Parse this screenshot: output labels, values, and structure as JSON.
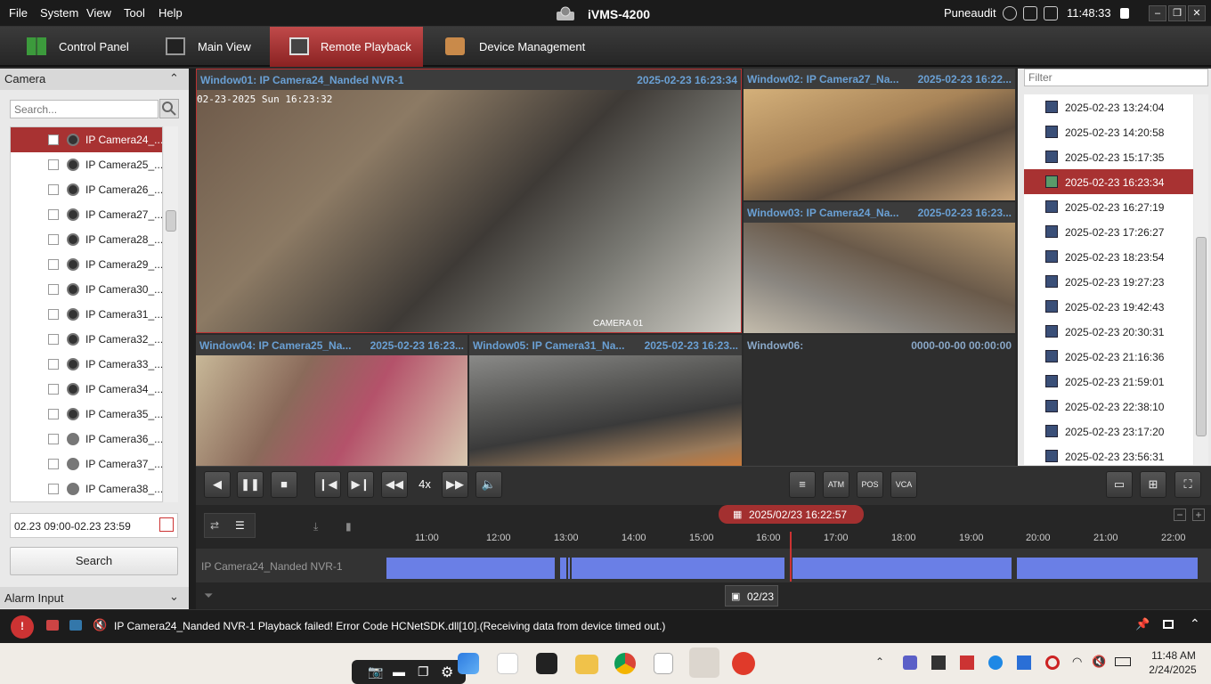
{
  "menubar": {
    "items": [
      "File",
      "System",
      "View",
      "Tool",
      "Help"
    ],
    "title": "iVMS-4200",
    "user": "Puneaudit",
    "clock": "11:48:33"
  },
  "modules": [
    {
      "label": "Control Panel"
    },
    {
      "label": "Main View"
    },
    {
      "label": "Remote Playback"
    },
    {
      "label": "Device Management"
    }
  ],
  "left": {
    "camera_header": "Camera",
    "search_placeholder": "Search...",
    "cameras": [
      "IP Camera24_...",
      "IP Camera25_...",
      "IP Camera26_...",
      "IP Camera27_...",
      "IP Camera28_...",
      "IP Camera29_...",
      "IP Camera30_...",
      "IP Camera31_...",
      "IP Camera32_...",
      "IP Camera33_...",
      "IP Camera34_...",
      "IP Camera35_...",
      "IP Camera36_...",
      "IP Camera37_...",
      "IP Camera38_..."
    ],
    "time_range": "02.23 09:00-02.23 23:59",
    "search_button": "Search",
    "alarm_header": "Alarm Input"
  },
  "windows": [
    {
      "title": "Window01:  IP Camera24_Nanded NVR-1",
      "time": "2025-02-23 16:23:34",
      "osd": "02-23-2025 Sun 16:23:32",
      "label": "CAMERA 01"
    },
    {
      "title": "Window02:  IP Camera27_Na...",
      "time": "2025-02-23 16:22..."
    },
    {
      "title": "Window03:  IP Camera24_Na...",
      "time": "2025-02-23 16:23..."
    },
    {
      "title": "Window04:  IP Camera25_Na...",
      "time": "2025-02-23 16:23..."
    },
    {
      "title": "Window05:  IP Camera31_Na...",
      "time": "2025-02-23 16:23..."
    },
    {
      "title": "Window06:",
      "time": "0000-00-00 00:00:00"
    }
  ],
  "right": {
    "filter_placeholder": "Filter",
    "records": [
      "2025-02-23 13:24:04",
      "2025-02-23 14:20:58",
      "2025-02-23 15:17:35",
      "2025-02-23 16:23:34",
      "2025-02-23 16:27:19",
      "2025-02-23 17:26:27",
      "2025-02-23 18:23:54",
      "2025-02-23 19:27:23",
      "2025-02-23 19:42:43",
      "2025-02-23 20:30:31",
      "2025-02-23 21:16:36",
      "2025-02-23 21:59:01",
      "2025-02-23 22:38:10",
      "2025-02-23 23:17:20",
      "2025-02-23 23:56:31"
    ],
    "selected_index": 3
  },
  "controls": {
    "speed": "4x",
    "atm": "ATM",
    "pos": "POS",
    "vca": "VCA"
  },
  "timeline": {
    "current": "2025/02/23 16:22:57",
    "ticks": [
      "11:00",
      "12:00",
      "13:00",
      "14:00",
      "15:00",
      "16:00",
      "17:00",
      "18:00",
      "19:00",
      "20:00",
      "21:00",
      "22:00"
    ],
    "camera": "IP Camera24_Nanded NVR-1",
    "date": "02/23"
  },
  "status": {
    "message": "IP Camera24_Nanded NVR-1 Playback failed! Error Code HCNetSDK.dll[10].(Receiving data from device timed out.)"
  },
  "taskbar": {
    "time": "11:48 AM",
    "date": "2/24/2025"
  },
  "colors": {
    "accent_red": "#a83232",
    "window_title_blue": "#6aa0d4",
    "recording_segment": "#6a7fe6"
  }
}
